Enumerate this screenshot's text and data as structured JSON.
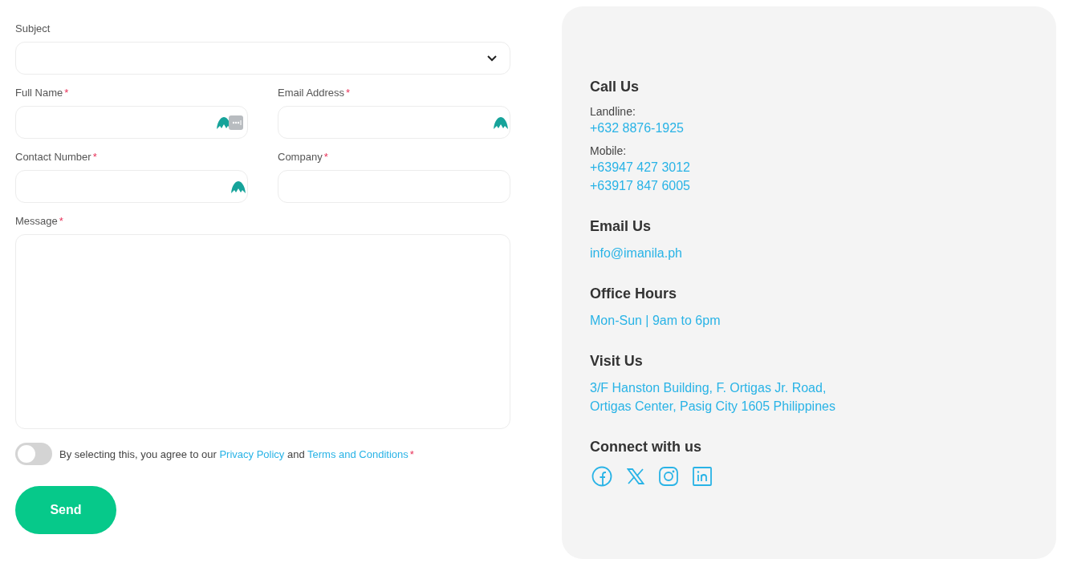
{
  "form": {
    "fields": [
      {
        "kind": "select",
        "label": "Subject",
        "required": false
      },
      {
        "kind": "text",
        "label": "Full Name",
        "required": true,
        "autofill_icon": true,
        "password_icon": true
      },
      {
        "kind": "text",
        "label": "Email Address",
        "required": true,
        "autofill_icon": true,
        "password_icon": false
      },
      {
        "kind": "text",
        "label": "Contact Number",
        "required": true,
        "autofill_icon": true,
        "password_icon": false
      },
      {
        "kind": "text",
        "label": "Company",
        "required": true,
        "autofill_icon": false,
        "password_icon": false
      },
      {
        "kind": "textarea",
        "label": "Message",
        "required": true
      }
    ],
    "required_mark": "*",
    "consent": {
      "on": false,
      "text_before": "By selecting this, you agree to our",
      "link_1": "Privacy Policy",
      "text_between": "and",
      "link_2": "Terms and Conditions",
      "required": true
    },
    "submit": "Send"
  },
  "contact": {
    "sections": [
      {
        "heading": "Call Us",
        "items": [
          {
            "kind": "label",
            "text": "Landline:"
          },
          {
            "kind": "link",
            "text": "+632 8876-1925"
          },
          {
            "kind": "label",
            "text": "Mobile:"
          },
          {
            "kind": "link",
            "text": "+63947 427 3012"
          },
          {
            "kind": "link",
            "text": "+63917 847 6005"
          }
        ]
      },
      {
        "heading": "Email Us",
        "items": [
          {
            "kind": "link",
            "text": "info@imanila.ph"
          }
        ]
      },
      {
        "heading": "Office Hours",
        "items": [
          {
            "kind": "link",
            "text": "Mon-Sun | 9am to 6pm"
          }
        ]
      },
      {
        "heading": "Visit Us",
        "items": [
          {
            "kind": "link",
            "text": "3/F Hanston Building, F. Ortigas Jr. Road,"
          },
          {
            "kind": "link",
            "text": "Ortigas Center, Pasig City 1605 Philippines"
          }
        ]
      }
    ],
    "social": {
      "heading": "Connect with us",
      "icons": [
        {
          "kind": "facebook"
        },
        {
          "kind": "x"
        },
        {
          "kind": "instagram"
        },
        {
          "kind": "linkedin"
        }
      ]
    }
  }
}
